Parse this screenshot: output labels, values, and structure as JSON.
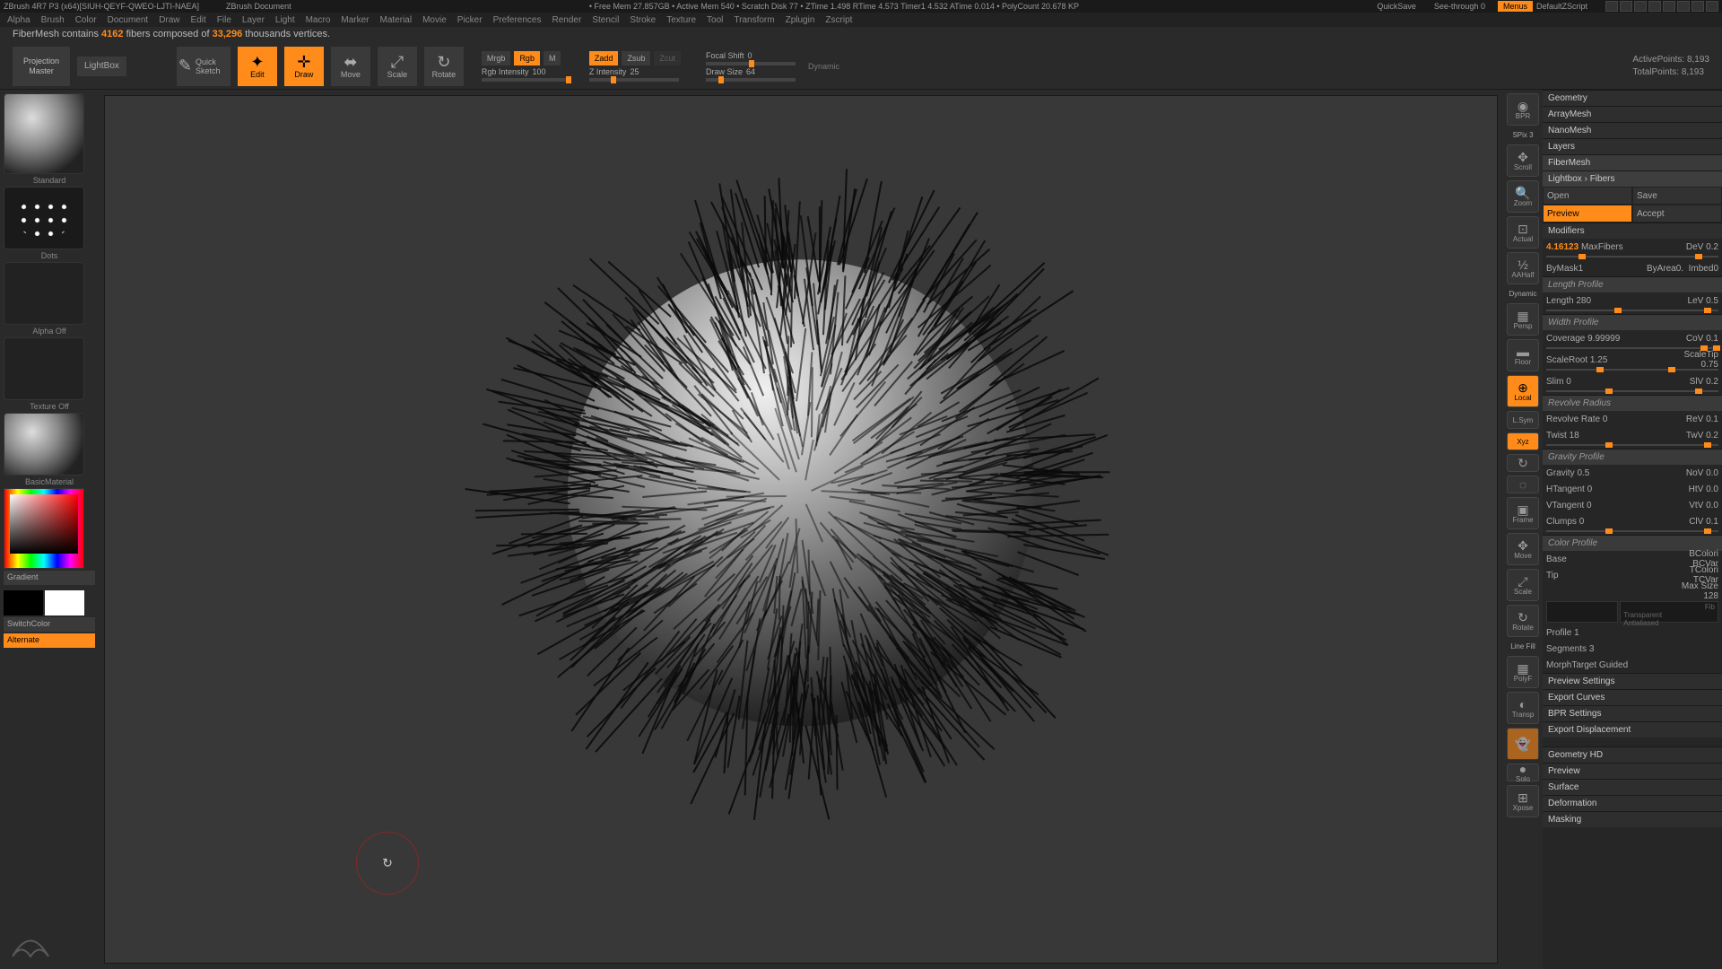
{
  "titlebar": {
    "app": "ZBrush 4R7 P3 (x64)[SIUH-QEYF-QWEO-LJTI-NAEA]",
    "doc": "ZBrush Document",
    "stats": "• Free Mem 27.857GB • Active Mem 540 • Scratch Disk 77 • ZTime 1.498 RTime 4.573 Timer1 4.532 ATime 0.014 • PolyCount 20.678 KP",
    "quicksave": "QuickSave",
    "seethrough": "See-through   0",
    "menus": "Menus",
    "defscript": "DefaultZScript"
  },
  "menubar": [
    "Alpha",
    "Brush",
    "Color",
    "Document",
    "Draw",
    "Edit",
    "File",
    "Layer",
    "Light",
    "Macro",
    "Marker",
    "Material",
    "Movie",
    "Picker",
    "Preferences",
    "Render",
    "Stencil",
    "Stroke",
    "Texture",
    "Tool",
    "Transform",
    "Zplugin",
    "Zscript"
  ],
  "status": {
    "prefix": "FiberMesh contains ",
    "fibers": "4162",
    "mid": " fibers composed of ",
    "verts": "33,296",
    "suffix": " thousands vertices."
  },
  "toolbar": {
    "projection": "Projection Master",
    "lightbox": "LightBox",
    "quicksketch": "Quick Sketch",
    "tools": [
      {
        "label": "Edit",
        "active": true
      },
      {
        "label": "Draw",
        "active": true
      },
      {
        "label": "Move",
        "active": false
      },
      {
        "label": "Scale",
        "active": false
      },
      {
        "label": "Rotate",
        "active": false
      }
    ],
    "mrgb": {
      "mrgb": "Mrgb",
      "rgb": "Rgb",
      "m": "M",
      "intensity_lbl": "Rgb Intensity",
      "intensity_val": "100"
    },
    "zadd": {
      "zadd": "Zadd",
      "zsub": "Zsub",
      "zcut": "Zcut",
      "zint_lbl": "Z Intensity",
      "zint_val": "25"
    },
    "focal": {
      "lbl": "Focal Shift",
      "val": "0"
    },
    "drawsize": {
      "lbl": "Draw Size",
      "val": "64"
    },
    "dynamic": "Dynamic",
    "active_pts": "ActivePoints: 8,193",
    "total_pts": "TotalPoints: 8,193"
  },
  "left": {
    "standard": "Standard",
    "dots": "Dots",
    "alpha": "Alpha Off",
    "texture": "Texture Off",
    "material": "BasicMaterial",
    "gradient": "Gradient",
    "switch": "SwitchColor",
    "alternate": "Alternate"
  },
  "rightnav": [
    "BPR",
    "Scroll",
    "Zoom",
    "Actual",
    "AAHalf",
    "Persp",
    "Floor",
    "Local",
    "L.Sym",
    "Xpose",
    "Frame",
    "Move",
    "Scale",
    "Rotate",
    "PolyF",
    "Transp",
    "Ghost",
    "Solo",
    "Xpose"
  ],
  "rightnav_extras": {
    "spix": "SPix 3",
    "dynamic": "Dynamic",
    "linefill": "Line Fill"
  },
  "sections": {
    "geometry": "Geometry",
    "arraymesh": "ArrayMesh",
    "nanomesh": "NanoMesh",
    "layers": "Layers",
    "fibermesh": "FiberMesh",
    "lightbox_fibers": "Lightbox › Fibers",
    "geometry_hd": "Geometry HD",
    "preview2": "Preview",
    "surface": "Surface",
    "deformation": "Deformation",
    "masking": "Masking"
  },
  "fiber": {
    "open": "Open",
    "save": "Save",
    "preview": "Preview",
    "accept": "Accept",
    "modifiers": "Modifiers",
    "maxfibers": {
      "val": "4.16123",
      "lbl": "MaxFibers",
      "dev_lbl": "DeV",
      "dev": "0.2"
    },
    "bymask": {
      "lbl": "ByMask",
      "val": "1",
      "byarea_lbl": "ByArea",
      "byarea": "0.",
      "imbed_lbl": "Imbed",
      "imbed": "0"
    },
    "length_profile": "Length Profile",
    "length": {
      "lbl": "Length",
      "val": "280",
      "lev_lbl": "LeV",
      "lev": "0.5"
    },
    "width_profile": "Width Profile",
    "coverage": {
      "lbl": "Coverage",
      "val": "9.99999",
      "cov_lbl": "CoV",
      "cov": "0.1"
    },
    "scaleroot": {
      "lbl": "ScaleRoot",
      "val": "1.25",
      "tip_lbl": "ScaleTip",
      "tip": "0.75"
    },
    "slim": {
      "lbl": "Slim",
      "val": "0",
      "slv_lbl": "SlV",
      "slv": "0.2"
    },
    "revolve_radius": "Revolve Radius",
    "revolve_rate": {
      "lbl": "Revolve Rate",
      "val": "0",
      "rev_lbl": "ReV",
      "rev": "0.1"
    },
    "twist": {
      "lbl": "Twist",
      "val": "18",
      "twv_lbl": "TwV",
      "twv": "0.2"
    },
    "gravity_profile": "Gravity Profile",
    "gravity": {
      "lbl": "Gravity",
      "val": "0.5",
      "nov_lbl": "NoV",
      "nov": "0.0"
    },
    "htangent": {
      "lbl": "HTangent",
      "val": "0",
      "htv_lbl": "HtV",
      "htv": "0.0"
    },
    "vtangent": {
      "lbl": "VTangent",
      "val": "0",
      "vtv_lbl": "VtV",
      "vtv": "0.0"
    },
    "clumps": {
      "lbl": "Clumps",
      "val": "0",
      "clv_lbl": "ClV",
      "clv": "0.1"
    },
    "color_profile": "Color Profile",
    "base": "Base",
    "tip": "Tip",
    "bcolor": "BColori",
    "bcvar": "BCVar",
    "tcolor": "TColori",
    "tcvar": "TCVar",
    "maxsize": {
      "lbl": "Max Size",
      "val": "128"
    },
    "transparent": "Transparent",
    "antialiased": "Antialiased",
    "fiber_only": "Fib",
    "profile1": "Profile 1",
    "segments": {
      "lbl": "Segments",
      "val": "3"
    },
    "morphtarget": "MorphTarget Guided",
    "preview_settings": "Preview Settings",
    "export_curves": "Export Curves",
    "bpr_settings": "BPR Settings",
    "export_disp": "Export Displacement"
  }
}
